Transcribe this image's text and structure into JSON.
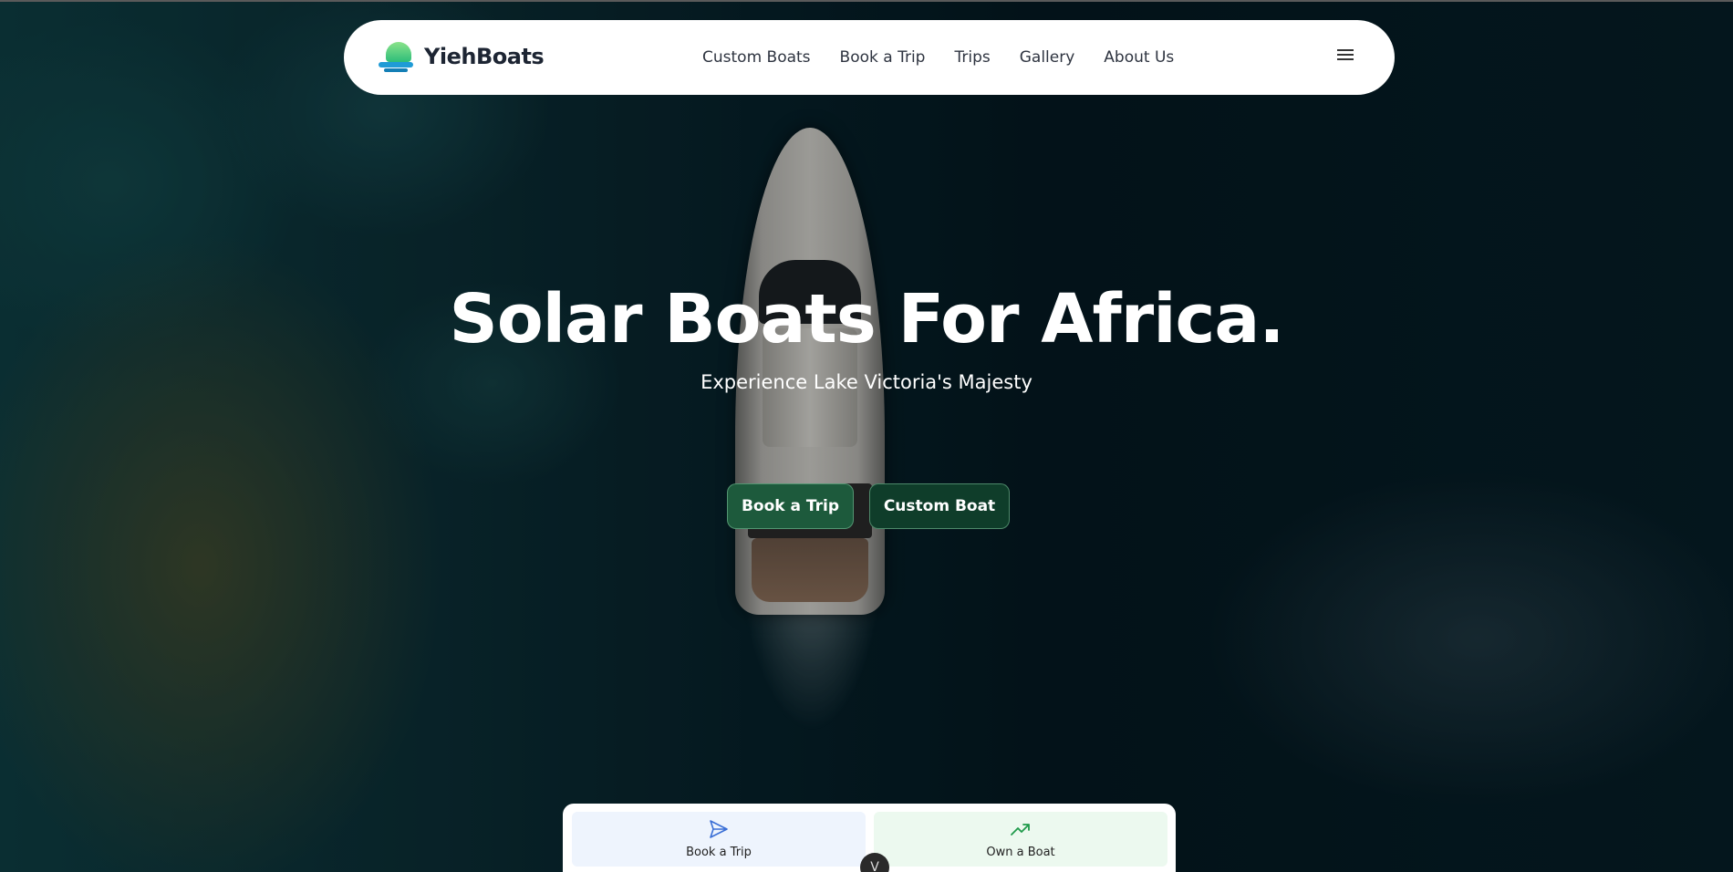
{
  "nav": {
    "brand": "YiehBoats",
    "links": [
      "Custom Boats",
      "Book a Trip",
      "Trips",
      "Gallery",
      "About Us"
    ],
    "menu_icon": "hamburger-icon"
  },
  "hero": {
    "title": "Solar Boats For Africa.",
    "subtitle": "Experience Lake Victoria's Majesty",
    "buttons": {
      "book": "Book a Trip",
      "custom": "Custom Boat"
    }
  },
  "quick_actions": {
    "book": {
      "label": "Book a Trip",
      "icon": "send-icon"
    },
    "own": {
      "label": "Own a Boat",
      "icon": "trending-up-icon"
    }
  },
  "scroll": {
    "glyph": "V",
    "icon": "chevron-down-icon"
  },
  "colors": {
    "brand_dark": "#1d2533",
    "cta_trip": "#1d5a3c",
    "cta_custom": "#0f3d2a",
    "tile_trip_bg": "#eef4fd",
    "tile_own_bg": "#ecf9ef",
    "send_icon": "#3b6fd6",
    "trend_icon": "#1f9a4a"
  }
}
